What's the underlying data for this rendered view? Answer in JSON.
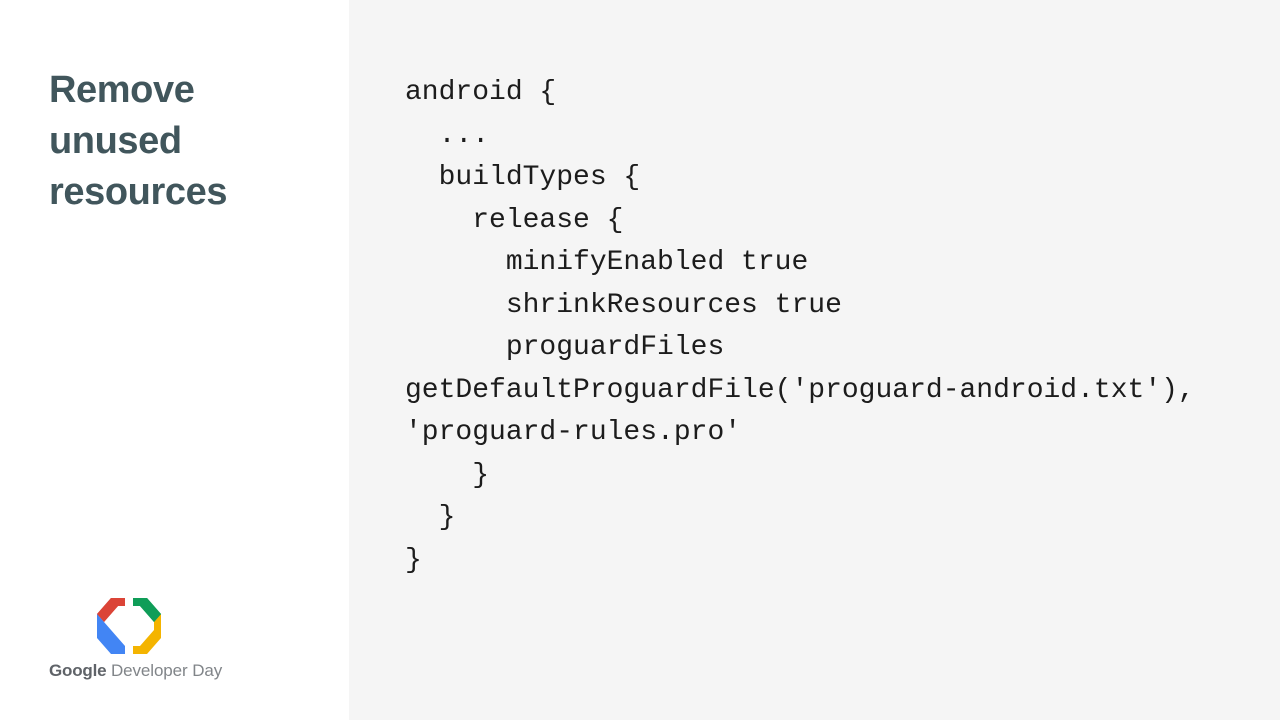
{
  "slide": {
    "title": "Remove unused resources",
    "title_lines": [
      "Remove",
      "unused",
      "resources"
    ],
    "background_left": "#ffffff",
    "background_right": "#f5f5f5",
    "title_color": "#41565c"
  },
  "logo": {
    "name": "google-developer-day-logo",
    "wordmark_primary": "Google",
    "wordmark_secondary": " Developer Day",
    "colors": {
      "red": "#db4437",
      "blue": "#4285f4",
      "green": "#0f9d58",
      "yellow": "#f4b400"
    }
  },
  "code": {
    "language": "groovy",
    "text": "android {\n  ...\n  buildTypes {\n    release {\n      minifyEnabled true\n      shrinkResources true\n      proguardFiles\ngetDefaultProguardFile('proguard-android.txt'),\n'proguard-rules.pro'\n    }\n  }\n}",
    "lines": [
      "android {",
      "  ...",
      "  buildTypes {",
      "    release {",
      "      minifyEnabled true",
      "      shrinkResources true",
      "      proguardFiles",
      "getDefaultProguardFile('proguard-android.txt'),",
      "'proguard-rules.pro'",
      "    }",
      "  }",
      "}"
    ]
  }
}
